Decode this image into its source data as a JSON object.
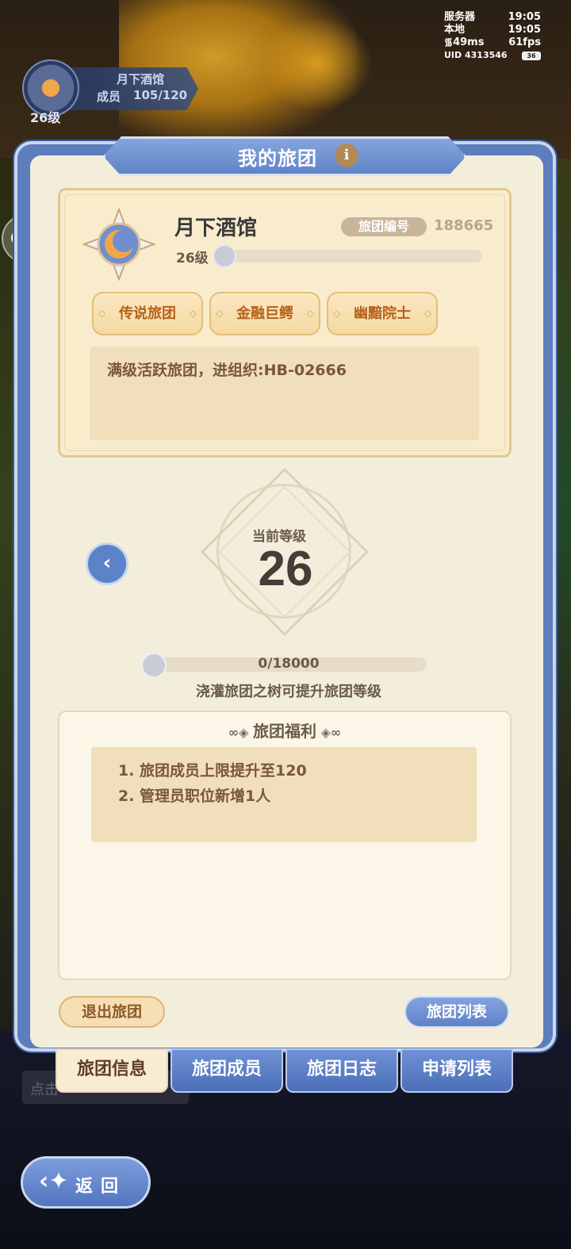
{
  "status": {
    "server_label": "服务器",
    "server_time": "19:05",
    "local_label": "本地",
    "local_time": "19:05",
    "ping": "49ms",
    "fps": "61fps",
    "uid": "UID 4313546",
    "battery": "36"
  },
  "guild_header": {
    "name": "月下酒馆",
    "members_label": "成员",
    "members": "105/120",
    "level": "26级"
  },
  "panel": {
    "title": "我的旅团",
    "info_icon": "i"
  },
  "guild": {
    "name": "月下酒馆",
    "id_label": "旅团编号",
    "id": "188665",
    "level": "26级",
    "level_progress": 0.0,
    "tags": [
      "传说旅团",
      "金融巨鳄",
      "幽黯院士"
    ],
    "motto": "满级活跃旅团，进组织:HB-02666"
  },
  "level_center": {
    "label": "当前等级",
    "value": "26",
    "exp": "0/18000",
    "hint": "浇灌旅团之树可提升旅团等级"
  },
  "benefits": {
    "title": "旅团福利",
    "items": [
      "1.  旅团成员上限提升至120",
      "2.  管理员职位新增1人"
    ]
  },
  "buttons": {
    "quit": "退出旅团",
    "list": "旅团列表",
    "return": "返回"
  },
  "tabs": [
    "旅团信息",
    "旅团成员",
    "旅团日志",
    "申请列表"
  ],
  "chat_placeholder": "点击"
}
